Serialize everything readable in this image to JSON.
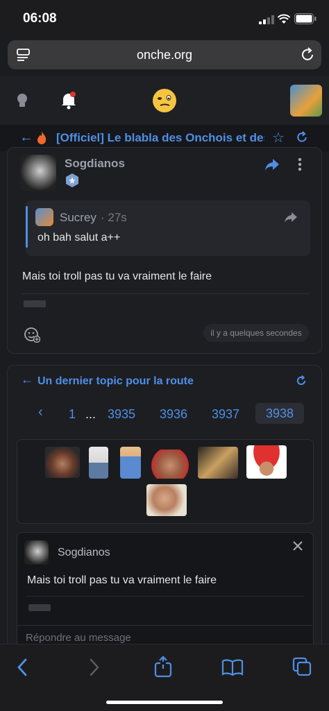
{
  "status": {
    "time": "06:08"
  },
  "browser": {
    "url": "onche.org"
  },
  "topic": {
    "title": "[Officiel] Le blabla des Onchois et des"
  },
  "post": {
    "author": "Sogdianos",
    "quote": {
      "author": "Sucrey",
      "time": "· 27s",
      "text": "oh bah salut a++"
    },
    "body": "Mais toi troll pas tu va vraiment le faire",
    "timestamp": "il y a quelques secondes"
  },
  "panel": {
    "title": "Un dernier topic pour la route",
    "pages": [
      "1",
      "...",
      "3935",
      "3936",
      "3937",
      "3938"
    ],
    "current_page": "3938",
    "prev_label": "‹"
  },
  "reply": {
    "author": "Sogdianos",
    "text": "Mais toi troll pas tu va vraiment le faire",
    "placeholder": "Répondre au message"
  },
  "colors": {
    "accent": "#4f8fe6",
    "background": "#1b1c20"
  }
}
